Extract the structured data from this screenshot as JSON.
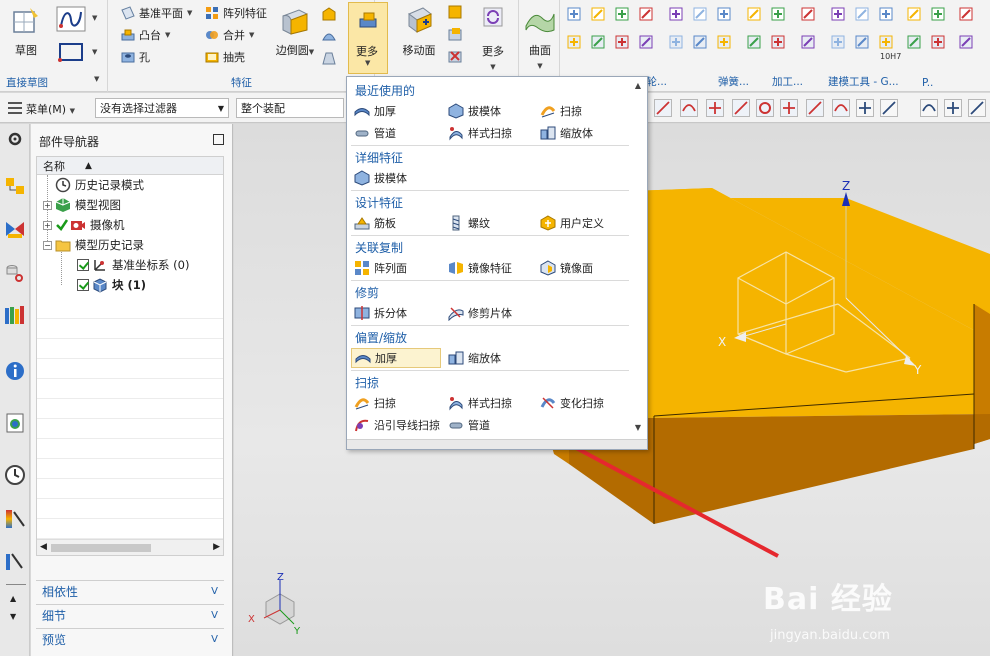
{
  "ribbon": {
    "sketch_label": "草图",
    "direct_sketch_caption": "直接草图",
    "feature_caption": "特征",
    "datum_plane_label": "基准平面",
    "pattern_feature_label": "阵列特征",
    "boss_label": "凸台",
    "combine_label": "合并",
    "hole_label": "孔",
    "shell_label": "抽壳",
    "edge_blend_label": "边倒圆",
    "more_label_1": "更多",
    "move_face_label": "移动面",
    "more_label_2": "更多",
    "surface_label": "曲面",
    "gear_caption": "齿轮...",
    "spring_caption": "弹簧...",
    "machining_caption": "加工...",
    "modeling_tools_caption": "建模工具 - G...",
    "p_caption": "P..",
    "tenh7_label": "10H7"
  },
  "toolbar": {
    "menu_label": "菜单(M)",
    "filter_value": "没有选择过滤器",
    "assembly_value": "整个装配"
  },
  "navigator": {
    "title": "部件导航器",
    "column_name": "名称",
    "items": [
      {
        "label": "历史记录模式"
      },
      {
        "label": "模型视图"
      },
      {
        "label": "摄像机"
      },
      {
        "label": "模型历史记录"
      },
      {
        "label": "基准坐标系 (0)"
      },
      {
        "label": "块 (1)"
      }
    ],
    "sections": [
      {
        "label": "相依性"
      },
      {
        "label": "细节"
      },
      {
        "label": "预览"
      }
    ]
  },
  "menu": {
    "groups": [
      {
        "title": "最近使用的",
        "items": [
          "加厚",
          "拔模体",
          "扫掠",
          "管道",
          "样式扫掠",
          "缩放体"
        ]
      },
      {
        "title": "详细特征",
        "items": [
          "拔模体"
        ]
      },
      {
        "title": "设计特征",
        "items": [
          "筋板",
          "螺纹",
          "用户定义"
        ]
      },
      {
        "title": "关联复制",
        "items": [
          "阵列面",
          "镜像特征",
          "镜像面"
        ]
      },
      {
        "title": "修剪",
        "items": [
          "拆分体",
          "修剪片体"
        ]
      },
      {
        "title": "偏置/缩放",
        "items": [
          "加厚",
          "缩放体"
        ]
      },
      {
        "title": "扫掠",
        "items": [
          "扫掠",
          "样式扫掠",
          "变化扫掠",
          "沿引导线扫掠",
          "管道"
        ]
      }
    ]
  },
  "viewport": {
    "axis_x": "X",
    "axis_y": "Y",
    "axis_z": "Z",
    "block_color": "#f5b400",
    "block_side_color": "#c87c00",
    "block_front_color": "#b36b00"
  },
  "colors": {
    "accent": "#1f5fa8",
    "arrow": "#e5282e"
  },
  "watermark": {
    "text": "Bai 经验",
    "url": "jingyan.baidu.com"
  }
}
